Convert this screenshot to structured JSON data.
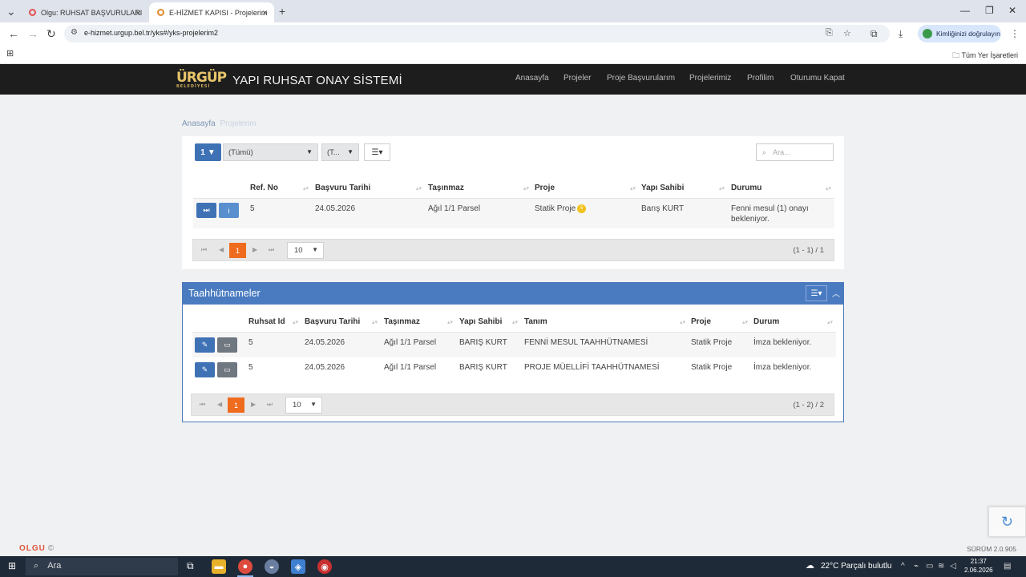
{
  "browser": {
    "tabs": [
      {
        "title": "Olgu: RUHSAT BAŞVURULARI",
        "active": false
      },
      {
        "title": "E-HİZMET KAPISI - Projelerim",
        "active": true
      }
    ],
    "url": "e-hizmet.urgup.bel.tr/yks#/yks-projelerim2",
    "identity_label": "Kimliğinizi doğrulayın",
    "bookmarks_all": "Tüm Yer İşaretleri"
  },
  "app": {
    "logo_text": "ÜRGÜP",
    "logo_sub": "BELEDİYESİ",
    "title": "YAPI RUHSAT ONAY SİSTEMİ",
    "menu": [
      "Anasayfa",
      "Projeler",
      "Proje Başvurularım",
      "Projelerimiz",
      "Profilim",
      "Oturumu Kapat"
    ]
  },
  "breadcrumb": {
    "home": "Anasayfa",
    "current": "Projelerim"
  },
  "projects": {
    "filter_count": "1",
    "select_all": "(Tümü)",
    "select_type": "(T...",
    "search_placeholder": "Ara...",
    "columns": [
      "Ref. No",
      "Başvuru Tarihi",
      "Taşınmaz",
      "Proje",
      "Yapı Sahibi",
      "Durumu"
    ],
    "rows": [
      {
        "ref": "5",
        "date": "24.05.2026",
        "tasinmaz": "Ağıl 1/1 Parsel",
        "proje": "Statik Proje",
        "badge": "5",
        "sahip": "Barış KURT",
        "durum": "Fenni mesul (1) onayı bekleniyor."
      }
    ],
    "pager": {
      "page": "1",
      "size": "10",
      "info": "(1 - 1) / 1"
    }
  },
  "commitments": {
    "title": "Taahhütnameler",
    "columns": [
      "Ruhsat Id",
      "Başvuru Tarihi",
      "Taşınmaz",
      "Yapı Sahibi",
      "Tanım",
      "Proje",
      "Durum"
    ],
    "rows": [
      {
        "id": "5",
        "date": "24.05.2026",
        "tasinmaz": "Ağıl 1/1 Parsel",
        "sahip": "BARIŞ KURT",
        "tanim": "FENNİ MESUL TAAHHÜTNAMESİ",
        "proje": "Statik Proje",
        "durum": "İmza bekleniyor."
      },
      {
        "id": "5",
        "date": "24.05.2026",
        "tasinmaz": "Ağıl 1/1 Parsel",
        "sahip": "BARIŞ KURT",
        "tanim": "PROJE MÜELLİFİ TAAHHÜTNAMESİ",
        "proje": "Statik Proje",
        "durum": "İmza bekleniyor."
      }
    ],
    "pager": {
      "page": "1",
      "size": "10",
      "info": "(1 - 2) / 2"
    }
  },
  "footer": {
    "brand": "OLGU",
    "copyright": "©",
    "version": "SÜRÜM 2.0.905"
  },
  "taskbar": {
    "search": "Ara",
    "weather": "22°C  Parçalı bulutlu",
    "time": "21:37",
    "date": "2.06.2026"
  },
  "colors": {
    "primary": "#3f72b5",
    "panel_header": "#4a7bc0",
    "page_active": "#ef6c1e",
    "appbar": "#1d1d1d"
  }
}
